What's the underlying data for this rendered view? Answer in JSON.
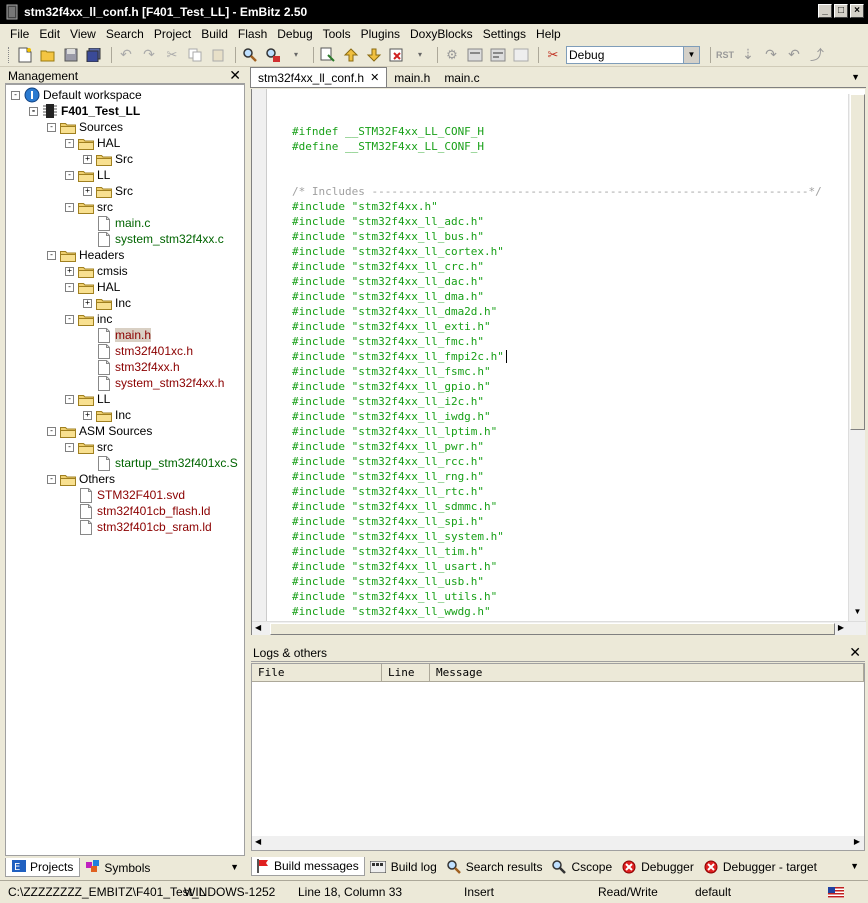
{
  "window": {
    "title": "stm32f4xx_ll_conf.h [F401_Test_LL] - EmBitz 2.50"
  },
  "menu": [
    "File",
    "Edit",
    "View",
    "Search",
    "Project",
    "Build",
    "Flash",
    "Debug",
    "Tools",
    "Plugins",
    "DoxyBlocks",
    "Settings",
    "Help"
  ],
  "toolbar": {
    "build_target": "Debug"
  },
  "management": {
    "title": "Management",
    "tree": [
      {
        "label": "Default workspace",
        "level": 0,
        "icon": "workspace-icon",
        "exp": "-",
        "kind": "workspace"
      },
      {
        "label": "F401_Test_LL",
        "level": 1,
        "icon": "chip-icon",
        "exp": "-",
        "kind": "project"
      },
      {
        "label": "Sources",
        "level": 2,
        "icon": "folder-icon",
        "exp": "-",
        "kind": "folder"
      },
      {
        "label": "HAL",
        "level": 3,
        "icon": "folder-icon",
        "exp": "-",
        "kind": "folder"
      },
      {
        "label": "Src",
        "level": 4,
        "icon": "folder-icon",
        "exp": "+",
        "kind": "folder"
      },
      {
        "label": "LL",
        "level": 3,
        "icon": "folder-icon",
        "exp": "-",
        "kind": "folder"
      },
      {
        "label": "Src",
        "level": 4,
        "icon": "folder-icon",
        "exp": "+",
        "kind": "folder"
      },
      {
        "label": "src",
        "level": 3,
        "icon": "folder-icon",
        "exp": "-",
        "kind": "folder"
      },
      {
        "label": "main.c",
        "level": 4,
        "icon": "file-icon",
        "exp": "",
        "kind": "src"
      },
      {
        "label": "system_stm32f4xx.c",
        "level": 4,
        "icon": "file-icon",
        "exp": "",
        "kind": "src"
      },
      {
        "label": "Headers",
        "level": 2,
        "icon": "folder-icon",
        "exp": "-",
        "kind": "folder"
      },
      {
        "label": "cmsis",
        "level": 3,
        "icon": "folder-icon",
        "exp": "+",
        "kind": "folder"
      },
      {
        "label": "HAL",
        "level": 3,
        "icon": "folder-icon",
        "exp": "-",
        "kind": "folder"
      },
      {
        "label": "Inc",
        "level": 4,
        "icon": "folder-icon",
        "exp": "+",
        "kind": "folder"
      },
      {
        "label": "inc",
        "level": 3,
        "icon": "folder-icon",
        "exp": "-",
        "kind": "folder"
      },
      {
        "label": "main.h",
        "level": 4,
        "icon": "file-icon",
        "exp": "",
        "kind": "hdr-selected"
      },
      {
        "label": "stm32f401xc.h",
        "level": 4,
        "icon": "file-icon",
        "exp": "",
        "kind": "hdr"
      },
      {
        "label": "stm32f4xx.h",
        "level": 4,
        "icon": "file-icon",
        "exp": "",
        "kind": "hdr"
      },
      {
        "label": "system_stm32f4xx.h",
        "level": 4,
        "icon": "file-icon",
        "exp": "",
        "kind": "hdr"
      },
      {
        "label": "LL",
        "level": 3,
        "icon": "folder-icon",
        "exp": "-",
        "kind": "folder"
      },
      {
        "label": "Inc",
        "level": 4,
        "icon": "folder-icon",
        "exp": "+",
        "kind": "folder"
      },
      {
        "label": "ASM Sources",
        "level": 2,
        "icon": "folder-icon",
        "exp": "-",
        "kind": "folder"
      },
      {
        "label": "src",
        "level": 3,
        "icon": "folder-icon",
        "exp": "-",
        "kind": "folder"
      },
      {
        "label": "startup_stm32f401xc.S",
        "level": 4,
        "icon": "file-icon",
        "exp": "",
        "kind": "src"
      },
      {
        "label": "Others",
        "level": 2,
        "icon": "folder-icon",
        "exp": "-",
        "kind": "folder"
      },
      {
        "label": "STM32F401.svd",
        "level": 3,
        "icon": "file-icon",
        "exp": "",
        "kind": "hdr"
      },
      {
        "label": "stm32f401cb_flash.ld",
        "level": 3,
        "icon": "file-icon",
        "exp": "",
        "kind": "hdr"
      },
      {
        "label": "stm32f401cb_sram.ld",
        "level": 3,
        "icon": "file-icon",
        "exp": "",
        "kind": "hdr"
      }
    ],
    "tabs": [
      {
        "label": "Projects",
        "icon": "projects-icon",
        "active": true
      },
      {
        "label": "Symbols",
        "icon": "symbols-icon",
        "active": false
      }
    ]
  },
  "editor": {
    "tabs": [
      {
        "label": "stm32f4xx_ll_conf.h",
        "active": true,
        "closable": true
      },
      {
        "label": "main.h",
        "active": false,
        "closable": false
      },
      {
        "label": "main.c",
        "active": false,
        "closable": false
      }
    ],
    "code": [
      {
        "text": "#ifndef __STM32F4xx_LL_CONF_H",
        "kind": "code"
      },
      {
        "text": "#define __STM32F4xx_LL_CONF_H",
        "kind": "code"
      },
      {
        "text": "",
        "kind": "code"
      },
      {
        "text": "",
        "kind": "code"
      },
      {
        "text": "/* Includes ------------------------------------------------------------------*/",
        "kind": "comment"
      },
      {
        "text": "#include \"stm32f4xx.h\"",
        "kind": "code"
      },
      {
        "text": "#include \"stm32f4xx_ll_adc.h\"",
        "kind": "code"
      },
      {
        "text": "#include \"stm32f4xx_ll_bus.h\"",
        "kind": "code"
      },
      {
        "text": "#include \"stm32f4xx_ll_cortex.h\"",
        "kind": "code"
      },
      {
        "text": "#include \"stm32f4xx_ll_crc.h\"",
        "kind": "code"
      },
      {
        "text": "#include \"stm32f4xx_ll_dac.h\"",
        "kind": "code"
      },
      {
        "text": "#include \"stm32f4xx_ll_dma.h\"",
        "kind": "code"
      },
      {
        "text": "#include \"stm32f4xx_ll_dma2d.h\"",
        "kind": "code"
      },
      {
        "text": "#include \"stm32f4xx_ll_exti.h\"",
        "kind": "code"
      },
      {
        "text": "#include \"stm32f4xx_ll_fmc.h\"",
        "kind": "code"
      },
      {
        "text": "#include \"stm32f4xx_ll_fmpi2c.h\"",
        "kind": "code"
      },
      {
        "text": "#include \"stm32f4xx_ll_fsmc.h\"",
        "kind": "code"
      },
      {
        "text": "#include \"stm32f4xx_ll_gpio.h\"",
        "kind": "code"
      },
      {
        "text": "#include \"stm32f4xx_ll_i2c.h\"",
        "kind": "code"
      },
      {
        "text": "#include \"stm32f4xx_ll_iwdg.h\"",
        "kind": "code"
      },
      {
        "text": "#include \"stm32f4xx_ll_lptim.h\"",
        "kind": "code"
      },
      {
        "text": "#include \"stm32f4xx_ll_pwr.h\"",
        "kind": "code"
      },
      {
        "text": "#include \"stm32f4xx_ll_rcc.h\"",
        "kind": "code"
      },
      {
        "text": "#include \"stm32f4xx_ll_rng.h\"",
        "kind": "code"
      },
      {
        "text": "#include \"stm32f4xx_ll_rtc.h\"",
        "kind": "code"
      },
      {
        "text": "#include \"stm32f4xx_ll_sdmmc.h\"",
        "kind": "code"
      },
      {
        "text": "#include \"stm32f4xx_ll_spi.h\"",
        "kind": "code"
      },
      {
        "text": "#include \"stm32f4xx_ll_system.h\"",
        "kind": "code"
      },
      {
        "text": "#include \"stm32f4xx_ll_tim.h\"",
        "kind": "code"
      },
      {
        "text": "#include \"stm32f4xx_ll_usart.h\"",
        "kind": "code"
      },
      {
        "text": "#include \"stm32f4xx_ll_usb.h\"",
        "kind": "code"
      },
      {
        "text": "#include \"stm32f4xx_ll_utils.h\"",
        "kind": "code"
      },
      {
        "text": "#include \"stm32f4xx_ll_wwdg.h\"",
        "kind": "code"
      }
    ]
  },
  "logs": {
    "title": "Logs & others",
    "columns": [
      "File",
      "Line",
      "Message"
    ],
    "tabs": [
      {
        "label": "Build messages",
        "icon": "flag-icon",
        "active": true
      },
      {
        "label": "Build log",
        "icon": "build-log-icon",
        "active": false
      },
      {
        "label": "Search results",
        "icon": "search-icon",
        "active": false
      },
      {
        "label": "Cscope",
        "icon": "cscope-icon",
        "active": false
      },
      {
        "label": "Debugger",
        "icon": "debugger-icon",
        "active": false
      },
      {
        "label": "Debugger - target",
        "icon": "debugger-icon",
        "active": false
      }
    ]
  },
  "status": {
    "path": "C:\\ZZZZZZZZ_EMBITZ\\F401_Test_L",
    "encoding": "WINDOWS-1252",
    "position": "Line 18, Column 33",
    "mode": "Insert",
    "access": "Read/Write",
    "profile": "default"
  }
}
